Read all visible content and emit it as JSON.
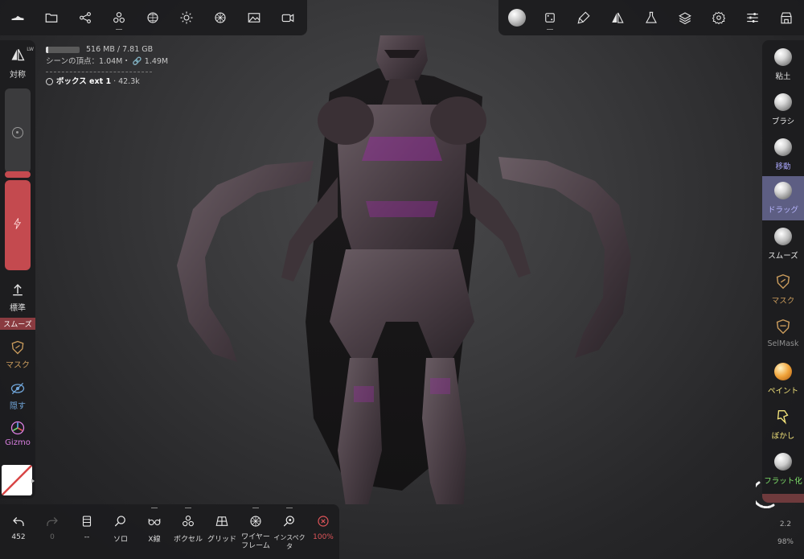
{
  "info": {
    "memory_text": "516 MB / 7.81 GB",
    "scene_vertices": "シーンの頂点：1.04M・",
    "scene_link_count": "1.49M",
    "object_name": "ボックス ext 1",
    "object_count": "42.3k"
  },
  "top_left_toolbar": {
    "icons": [
      "shoe-icon",
      "folder-icon",
      "share-icon",
      "voxel-icon",
      "sphere-icon",
      "sun-icon",
      "material-icon",
      "image-icon",
      "camera-icon"
    ]
  },
  "top_right_toolbar": {
    "icons": [
      "material-ball-icon",
      "dice-icon",
      "brush-icon",
      "symmetry-icon",
      "flask-icon",
      "layers-icon",
      "settings-icon",
      "sliders-icon",
      "store-icon"
    ]
  },
  "left_panel": {
    "symmetry_label": "対称",
    "symmetry_badge": "LW",
    "standard_label": "標準",
    "smooth_label": "スムーズ",
    "mask_label": "マスク",
    "hide_label": "隠す",
    "gizmo_label": "Gizmo"
  },
  "tools": [
    {
      "label": "粘土",
      "color": "#e6e6e6"
    },
    {
      "label": "ブラシ",
      "color": "#e6e6e6"
    },
    {
      "label": "移動",
      "color": "#a7a4f6"
    },
    {
      "label": "ドラッグ",
      "color": "#a7a4f6"
    },
    {
      "label": "スムーズ",
      "color": "#e6e6e6"
    },
    {
      "label": "マスク",
      "color": "#c99b5c"
    },
    {
      "label": "SelMask",
      "color": "#8f8f8f"
    },
    {
      "label": "ペイント",
      "color": "#f2e27a"
    },
    {
      "label": "ぼかし",
      "color": "#f2e27a"
    },
    {
      "label": "フラット化",
      "color": "#7fe16a"
    }
  ],
  "bottom_bar": {
    "undo_count": "452",
    "redo_count": "0",
    "layer_label": "--",
    "solo_label": "ソロ",
    "xray_label": "X線",
    "voxel_label": "ボクセル",
    "grid_label": "グリッド",
    "wireframe_label": "ワイヤーフレーム",
    "inspector_label": "インスペクタ",
    "opacity_label": "100%"
  },
  "bottom_right": {
    "value": "2.2",
    "percent": "98%"
  },
  "colors": {
    "accent_red": "#c44a4f",
    "active_tool_bg": "#5d5e83",
    "clay_model": "#51454c",
    "highlight_purple": "#9b2aa3"
  }
}
